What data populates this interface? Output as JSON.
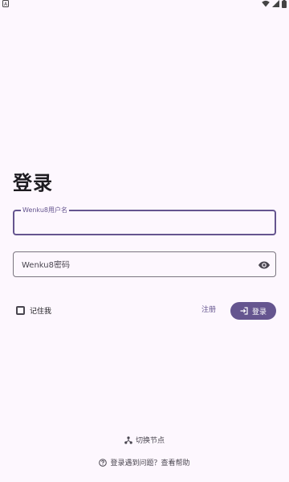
{
  "status_bar": {
    "left_icon": "a-notification-icon",
    "right_icons": [
      "wifi-icon",
      "signal-icon",
      "battery-icon"
    ]
  },
  "page": {
    "title": "登录"
  },
  "form": {
    "username": {
      "label": "Wenku8用户名",
      "value": ""
    },
    "password": {
      "placeholder": "Wenku8密码",
      "value": "",
      "toggle_icon": "eye-icon"
    },
    "remember_label": "记住我",
    "remember_checked": false,
    "register_label": "注册",
    "login_label": "登录",
    "login_icon": "login-icon"
  },
  "footer": {
    "switch_node_label": "切换节点",
    "switch_node_icon": "nodes-icon",
    "help_label": "登录遇到问题？查看帮助",
    "help_icon": "question-circle-icon"
  },
  "colors": {
    "primary": "#65558f",
    "background": "#fdf7fe",
    "outline": "#7a757f"
  }
}
